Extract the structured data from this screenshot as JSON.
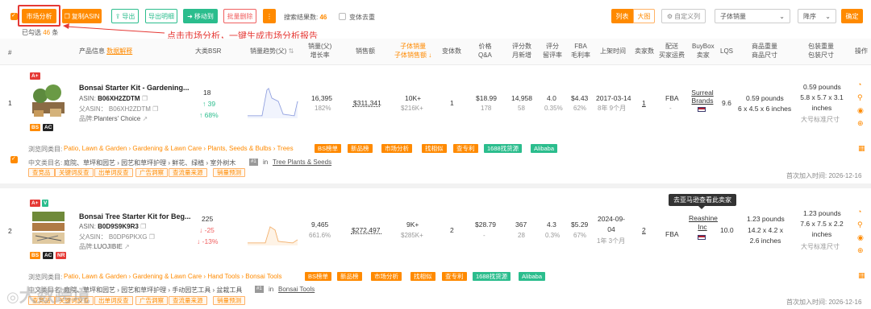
{
  "toolbar": {
    "market_analysis": "市场分析",
    "copy_asin": "复制ASIN",
    "export": "导出",
    "export_detail": "导出明细",
    "move_to": "移动到",
    "batch_delete": "批量删除",
    "more": "⋮",
    "result_label": "搜索结果数:",
    "result_count": "46",
    "variant_dedupe": "变体去重",
    "selected_label": "已勾选",
    "selected_count": "46",
    "selected_unit": "条",
    "view_list": "列表",
    "view_grid": "大图",
    "custom_columns": "自定义列",
    "sort_field": "子体销量",
    "sort_order": "降序",
    "confirm": "确定"
  },
  "annotation": "点击市场分析，一键生成市场分析报告",
  "columns": {
    "index": "#",
    "product_info": "产品信息",
    "data_explain": "数据解释",
    "rank_bsr": "大类BSR",
    "sales_trend": "销量趋势(父)",
    "sales_growth_1": "销量(父)",
    "sales_growth_2": "增长率",
    "revenue": "销售额",
    "child_sales_1": "子体销量",
    "child_sales_2": "子体销售额",
    "variants": "变体数",
    "price_1": "价格",
    "price_2": "Q&A",
    "reviews_1": "评分数",
    "reviews_2": "月新增",
    "rating_1": "评分",
    "rating_2": "留评率",
    "fba_1": "FBA",
    "fba_2": "毛利率",
    "launch": "上架时间",
    "sellers": "卖家数",
    "ship_1": "配送",
    "ship_2": "买家运费",
    "buybox_1": "BuyBox",
    "buybox_2": "卖家",
    "lqs": "LQS",
    "weight_1": "商品重量",
    "weight_2": "商品尺寸",
    "pkg_1": "包装重量",
    "pkg_2": "包装尺寸",
    "actions": "操作"
  },
  "rows": [
    {
      "index": "1",
      "title": "Bonsai Starter Kit - Gardening...",
      "asin_label": "ASIN:",
      "asin": "B06XH2ZDTM",
      "parent_label": "父ASIN：",
      "parent_asin": "B06XH2ZDTM",
      "brand_label": "品牌:",
      "brand": "Planters' Choice",
      "badge_top": "A+",
      "badges": [
        "BS",
        "AC"
      ],
      "bsr": "18",
      "bsr_change": "↑ 39",
      "bsr_pct": "↑ 68%",
      "sales": "16,395",
      "sales_growth": "182%",
      "revenue": "$311,341",
      "child_sales": "10K+",
      "child_revenue": "$216K+",
      "variants": "1",
      "price": "$18.99",
      "qa": "178",
      "reviews": "14,958",
      "reviews_new": "58",
      "rating": "4.0",
      "review_rate": "0.35%",
      "fba": "$4.43",
      "margin": "62%",
      "launch": "2017-03-14",
      "launch_age": "8年 9个月",
      "sellers": "1",
      "ship": "FBA",
      "ship_fee": "-",
      "buybox": "Surreal Brands",
      "lqs": "9.6",
      "weight": "0.59 pounds",
      "size": "6 x 4.5 x 6 inches",
      "pkg_weight": "0.59 pounds",
      "pkg_size": "5.8 x 5.7 x 3.1 inches",
      "pkg_tier": "大号标准尺寸",
      "category_label": "浏览同类目:",
      "category": "Patio, Lawn & Garden › Gardening & Lawn Care › Plants, Seeds & Bulbs › Trees",
      "actions": [
        "BS榜单",
        "新品榜",
        "市场分析",
        "找相似",
        "查专利",
        "1688找货源",
        "Alibaba"
      ],
      "cn_category_label": "中文类目名:",
      "cn_category": "庭院、草坪和园艺 › 园艺和草坪护理 › 鲜花、绿植 › 室外树木",
      "node_in": "in",
      "node": "Tree Plants & Seeds",
      "tools": [
        "查竞品",
        "关键词反查",
        "出单词反查",
        "广告洞察",
        "查流量来源",
        "销量预测"
      ],
      "first_added_label": "首次加入时间:",
      "first_added": "2026-12-16"
    },
    {
      "index": "2",
      "title": "Bonsai Tree Starter Kit for Beg...",
      "asin_label": "ASIN:",
      "asin": "B0D9S9K9R3",
      "parent_label": "父ASIN：",
      "parent_asin": "B0DP6PKXG",
      "brand_label": "品牌:",
      "brand": "LUOJIBIE",
      "badge_top": "A+",
      "badges": [
        "BS",
        "AC",
        "NR"
      ],
      "bsr": "225",
      "bsr_change": "↓ -25",
      "bsr_pct": "↓ -13%",
      "sales": "9,465",
      "sales_growth": "661.6%",
      "revenue": "$272,497",
      "child_sales": "9K+",
      "child_revenue": "$285K+",
      "variants": "2",
      "price": "$28.79",
      "qa": "-",
      "reviews": "367",
      "reviews_new": "28",
      "rating": "4.3",
      "review_rate": "0.3%",
      "fba": "$5.29",
      "margin": "67%",
      "launch": "2024-09-04",
      "launch_age": "1年 3个月",
      "sellers": "2",
      "ship": "FBA",
      "ship_fee": "-",
      "buybox": "Reashine Inc",
      "lqs": "10.0",
      "weight": "1.23 pounds",
      "size": "14.2 x 4.2 x 2.6 inches",
      "pkg_weight": "1.23 pounds",
      "pkg_size": "7.6 x 7.5 x 2.2 inches",
      "pkg_tier": "大号标准尺寸",
      "category_label": "浏览同类目:",
      "category": "Patio, Lawn & Garden › Gardening & Lawn Care › Hand Tools › Bonsai Tools",
      "actions": [
        "BS榜单",
        "新品榜",
        "市场分析",
        "找相似",
        "查专利",
        "1688找货源",
        "Alibaba"
      ],
      "cn_category_label": "中文类目名:",
      "cn_category": "庭院、草坪和园艺 › 园艺和草坪护理 › 手动园艺工具 › 盆栽工具",
      "node_in": "in",
      "node": "Bonsai Tools",
      "tools": [
        "查竞品",
        "关键词反查",
        "出单词反查",
        "广告洞察",
        "查流量来源",
        "销量预测"
      ],
      "first_added_label": "首次加入时间:",
      "first_added": "2026-12-16"
    }
  ],
  "tooltip": "去亚马逊查看此卖家",
  "watermark": "大数跨境",
  "colors": {
    "accent": "#ff8a00",
    "green": "#2bbd8d",
    "red": "#f06060"
  }
}
